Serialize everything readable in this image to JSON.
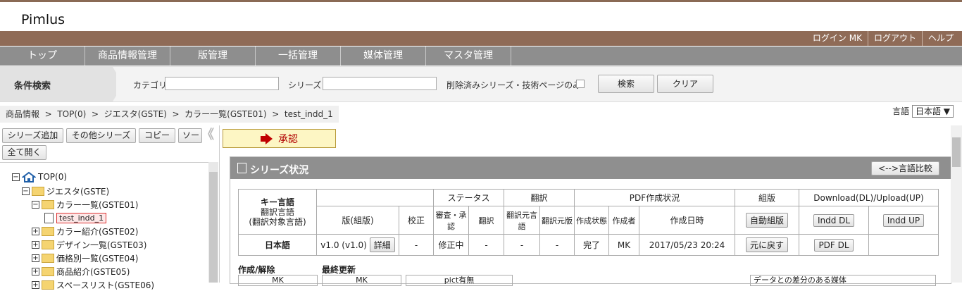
{
  "app": {
    "title": "Pimlus"
  },
  "userbar": {
    "items": [
      "ログイン MK",
      "ログアウト",
      "ヘルプ"
    ]
  },
  "nav": {
    "items": [
      "トップ",
      "商品情報管理",
      "版管理",
      "一括管理",
      "媒体管理",
      "マスタ管理"
    ]
  },
  "search": {
    "title": "条件検索",
    "category_label": "カテゴリ",
    "category_value": "",
    "series_label": "シリーズ",
    "series_value": "",
    "deleted_label": "削除済みシリーズ・技術ページのみ",
    "search_button": "検索",
    "clear_button": "クリア"
  },
  "breadcrumb": {
    "text": "商品情報  >  TOP(0)  >  ジエスタ(GSTE)  >  カラー一覧(GSTE01)  >  test_indd_1"
  },
  "language": {
    "label": "言語",
    "selected": "日本語 ▼"
  },
  "left": {
    "buttons": [
      "シリーズ追加",
      "その他シリーズ",
      "コピー",
      "ソー"
    ],
    "expand_all": "全て開く",
    "collapse_glyph": "《",
    "tree": [
      {
        "label": "TOP(0)",
        "pm": "−"
      },
      {
        "label": "ジエスタ(GSTE)",
        "pm": "−"
      },
      {
        "label": "カラー一覧(GSTE01)",
        "pm": "−"
      },
      {
        "label": "test_indd_1",
        "pm": ""
      },
      {
        "label": "カラー紹介(GSTE02)",
        "pm": "+"
      },
      {
        "label": "デザイン一覧(GSTE03)",
        "pm": "+"
      },
      {
        "label": "価格別一覧(GSTE04)",
        "pm": "+"
      },
      {
        "label": "商品紹介(GSTE05)",
        "pm": "+"
      },
      {
        "label": "スペースリスト(GSTE06)",
        "pm": "+"
      }
    ]
  },
  "right": {
    "approve_label": "承認",
    "panel_title": "シリーズ状況",
    "compare_button": "<-->言語比較",
    "table": {
      "key_lang": "キー言語",
      "trans_lang": "翻訳言語",
      "trans_target": "(翻訳対象言語)",
      "status_header": "ステータス",
      "translation_header": "翻訳",
      "pdf_header": "PDF作成状況",
      "layout_header": "組版",
      "dlul_header": "Download(DL)/Upload(UP)",
      "col_version": "版(組版)",
      "col_proof": "校正",
      "col_review": "審査・承認",
      "col_trans": "翻訳",
      "col_src_lang": "翻訳元言語",
      "col_src_ver": "翻訳元版",
      "col_pdf_state": "作成状態",
      "col_author": "作成者",
      "col_date": "作成日時",
      "btn_autolayout": "自動組版",
      "btn_indd_dl": "Indd DL",
      "btn_indd_up": "Indd UP",
      "row_lang": "日本語",
      "row_version": "v1.0 (v1.0)",
      "btn_detail": "詳細",
      "row_proof": "-",
      "row_review": "修正中",
      "row_trans": "-",
      "row_src_lang": "-",
      "row_src_ver": "-",
      "row_pdf_state": "完了",
      "row_author": "MK",
      "row_date": "2017/05/23 20:24",
      "btn_revert": "元に戻す",
      "btn_pdf_dl": "PDF DL"
    },
    "sub": {
      "created": "作成/解除",
      "updated": "最終更新",
      "diff_media": "データとの差分のある媒体",
      "mk1": "MK",
      "mk2": "MK",
      "pict": "pict有無"
    }
  }
}
